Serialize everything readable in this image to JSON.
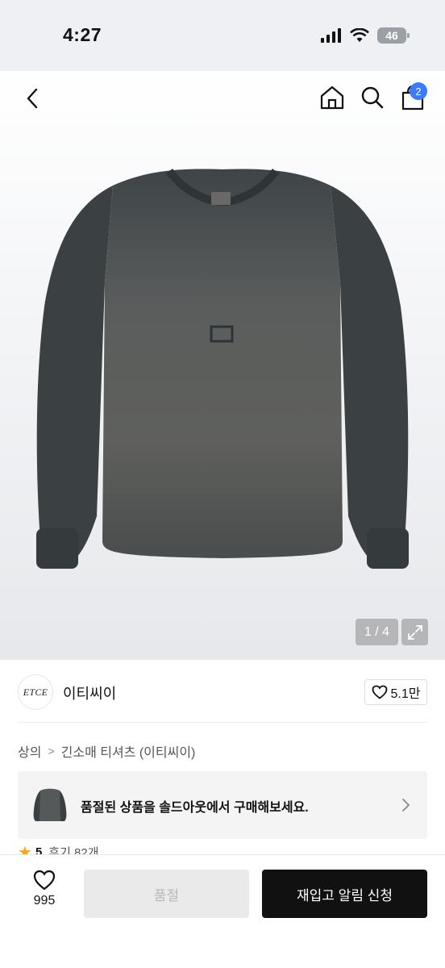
{
  "status_bar": {
    "time": "4:27",
    "battery": "46"
  },
  "nav": {
    "cart_count": "2"
  },
  "gallery": {
    "indicator": "1 / 4"
  },
  "brand": {
    "logo_text": "ETCE",
    "name": "이티씨이",
    "likes": "5.1만"
  },
  "breadcrumb": {
    "items": [
      "상의",
      "긴소매 티셔츠 (이티씨이)"
    ],
    "separator": ">"
  },
  "soldout_banner": {
    "text": "품절된 상품을 솔드아웃에서 구매해보세요."
  },
  "rating": {
    "star": "★",
    "value": "5",
    "reviews": "후기 82개"
  },
  "bottom_bar": {
    "wish_count": "995",
    "soldout_label": "품절",
    "notify_label": "재입고 알림 신청"
  },
  "colors": {
    "accent": "#3a7bff",
    "primary_button": "#111111",
    "disabled_button": "#eaeaea",
    "star": "#f5a623"
  },
  "icons": [
    "chevron-left-icon",
    "home-icon",
    "search-icon",
    "bag-icon",
    "expand-icon",
    "heart-icon",
    "chevron-right-icon"
  ]
}
